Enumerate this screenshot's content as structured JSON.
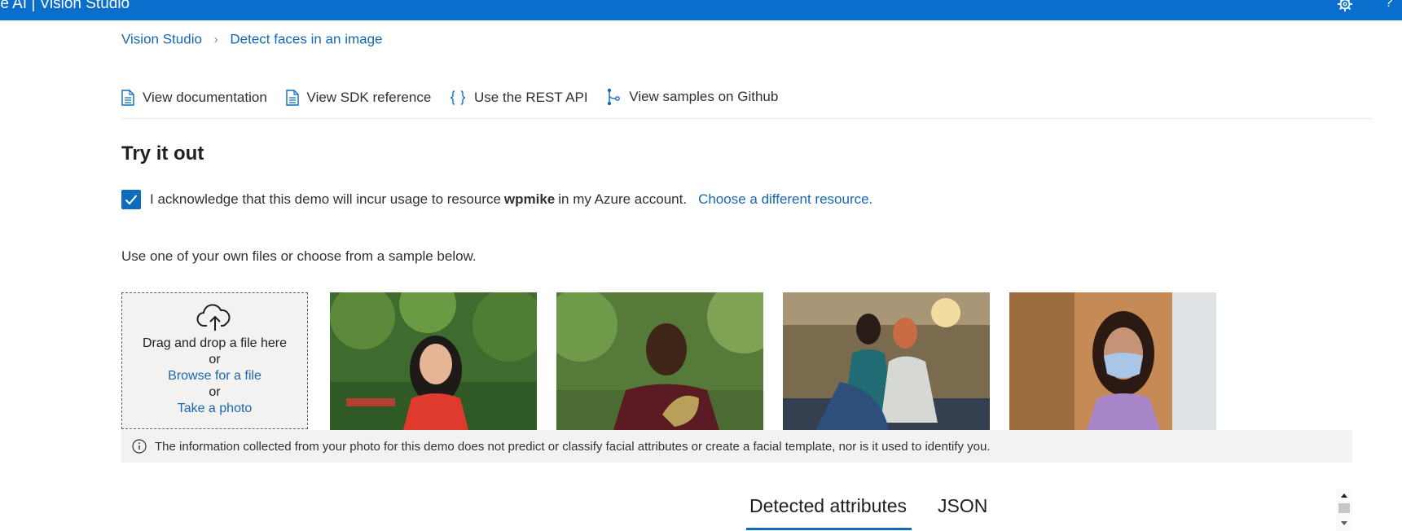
{
  "header": {
    "brand": "re AI  |  Vision Studio",
    "settings_icon": "gear-icon",
    "help_label": "?"
  },
  "breadcrumb": {
    "items": [
      "Vision Studio",
      "Detect faces in an image"
    ],
    "separator": "chevron-right-icon"
  },
  "resource_links": [
    {
      "label": "View documentation",
      "icon": "document-icon"
    },
    {
      "label": "View SDK reference",
      "icon": "document-icon"
    },
    {
      "label": "Use the REST API",
      "icon": "braces-icon"
    },
    {
      "label": "View samples on Github",
      "icon": "branch-icon"
    }
  ],
  "try_it": {
    "heading": "Try it out",
    "ack_prefix": "I acknowledge that this demo will incur usage to resource",
    "resource_name": "wpmike",
    "ack_suffix": "in my Azure account.",
    "choose_resource": "Choose a different resource.",
    "ack_checked": true,
    "instruction": "Use one of your own files or choose from a sample below."
  },
  "upload": {
    "icon": "cloud-upload-icon",
    "drag_text": "Drag and drop a file here",
    "or_1": "or",
    "browse": "Browse for a file",
    "or_2": "or",
    "take_photo": "Take a photo"
  },
  "samples": [
    {
      "description": "woman in red top outdoors"
    },
    {
      "description": "man holding face mask"
    },
    {
      "description": "two women in office"
    },
    {
      "description": "woman wearing face mask"
    }
  ],
  "notice": {
    "icon": "info-icon",
    "text": "The information collected from your photo for this demo does not predict or classify facial attributes or create a facial template, nor is it used to identify you."
  },
  "results_tabs": [
    {
      "label": "Detected attributes",
      "selected": true
    },
    {
      "label": "JSON",
      "selected": false
    }
  ],
  "colors": {
    "accent": "#0f6cbd",
    "header_bg": "#0a6fcc",
    "link": "#1767b3",
    "notice_bg": "#f3f2f1"
  }
}
